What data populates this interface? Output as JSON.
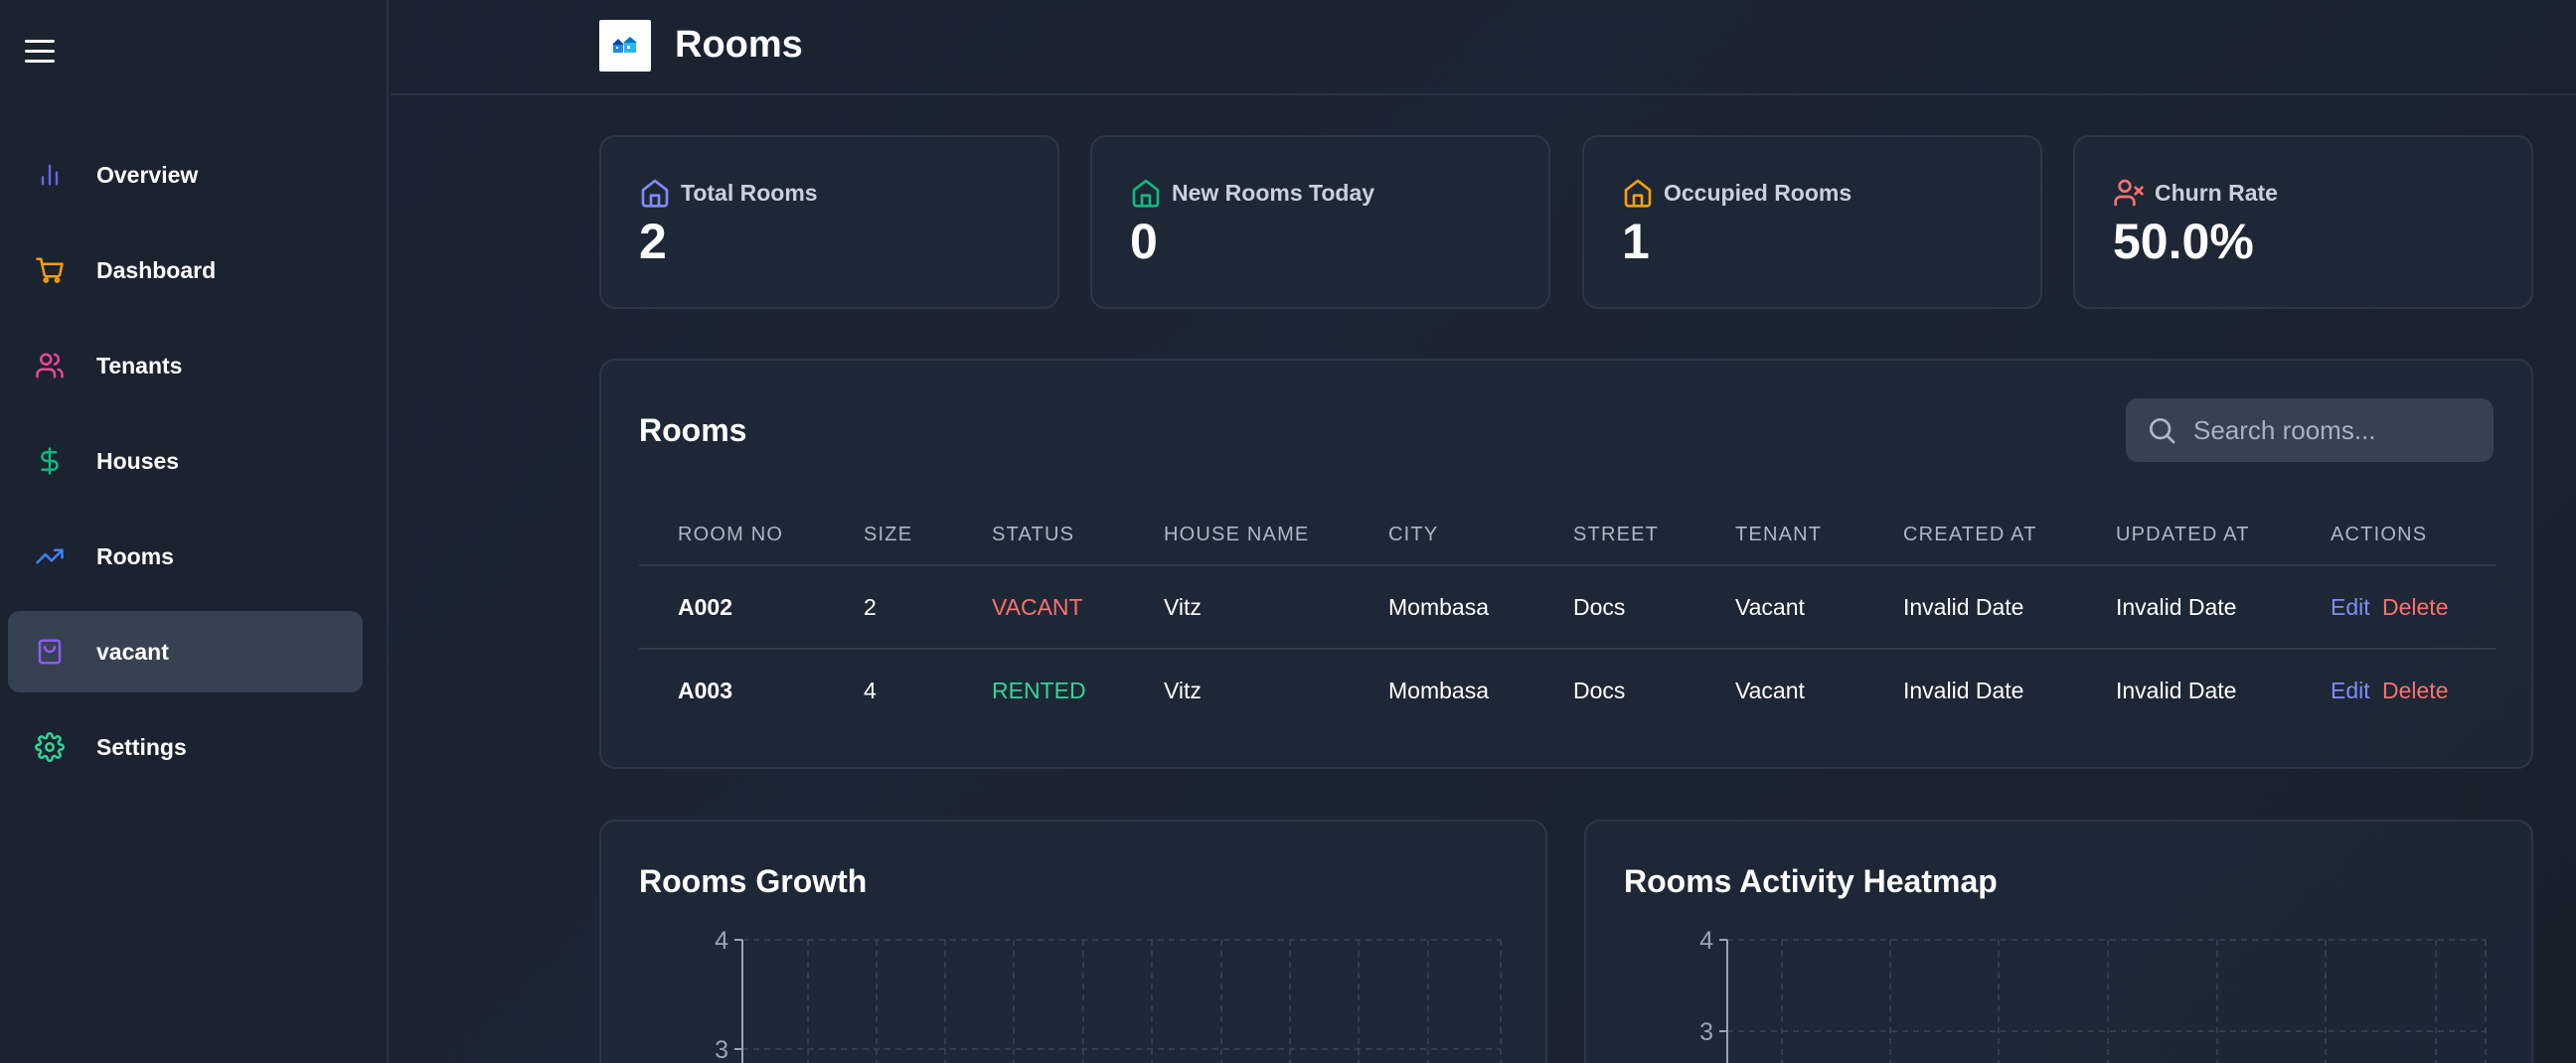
{
  "sidebar": {
    "items": [
      {
        "label": "Overview",
        "icon": "bar-chart-icon",
        "color": "#6366f1"
      },
      {
        "label": "Dashboard",
        "icon": "cart-icon",
        "color": "#f59e0b"
      },
      {
        "label": "Tenants",
        "icon": "users-icon",
        "color": "#ec4899"
      },
      {
        "label": "Houses",
        "icon": "dollar-icon",
        "color": "#10b981"
      },
      {
        "label": "Rooms",
        "icon": "trending-up-icon",
        "color": "#3b82f6"
      },
      {
        "label": "vacant",
        "icon": "shopping-bag-icon",
        "color": "#8b5cf6",
        "active": true
      },
      {
        "label": "Settings",
        "icon": "gear-icon",
        "color": "#34d399"
      }
    ]
  },
  "header": {
    "title": "Rooms"
  },
  "stats": [
    {
      "label": "Total Rooms",
      "value": "2",
      "icon": "house-icon",
      "color": "#818cf8"
    },
    {
      "label": "New Rooms Today",
      "value": "0",
      "icon": "house-icon",
      "color": "#10b981"
    },
    {
      "label": "Occupied Rooms",
      "value": "1",
      "icon": "house-icon",
      "color": "#f59e0b"
    },
    {
      "label": "Churn Rate",
      "value": "50.0%",
      "icon": "user-x-icon",
      "color": "#f87171"
    }
  ],
  "rooms": {
    "title": "Rooms",
    "search_placeholder": "Search rooms...",
    "columns": [
      "ROOM NO",
      "SIZE",
      "STATUS",
      "HOUSE NAME",
      "CITY",
      "STREET",
      "TENANT",
      "CREATED AT",
      "UPDATED AT",
      "ACTIONS"
    ],
    "rows": [
      {
        "room_no": "A002",
        "size": "2",
        "status": "VACANT",
        "house_name": "Vitz",
        "city": "Mombasa",
        "street": "Docs",
        "tenant": "Vacant",
        "created_at": "Invalid Date",
        "updated_at": "Invalid Date",
        "edit": "Edit",
        "delete": "Delete"
      },
      {
        "room_no": "A003",
        "size": "4",
        "status": "RENTED",
        "house_name": "Vitz",
        "city": "Mombasa",
        "street": "Docs",
        "tenant": "Vacant",
        "created_at": "Invalid Date",
        "updated_at": "Invalid Date",
        "edit": "Edit",
        "delete": "Delete"
      }
    ]
  },
  "chart_data": [
    {
      "type": "line",
      "title": "Rooms Growth",
      "xlabel": "",
      "ylabel": "",
      "y_tick_labels": [
        "4",
        "3"
      ],
      "grid": true,
      "series": []
    },
    {
      "type": "heatmap",
      "title": "Rooms Activity Heatmap",
      "xlabel": "",
      "ylabel": "",
      "y_tick_labels": [
        "4",
        "3"
      ],
      "grid": true,
      "series": []
    }
  ]
}
